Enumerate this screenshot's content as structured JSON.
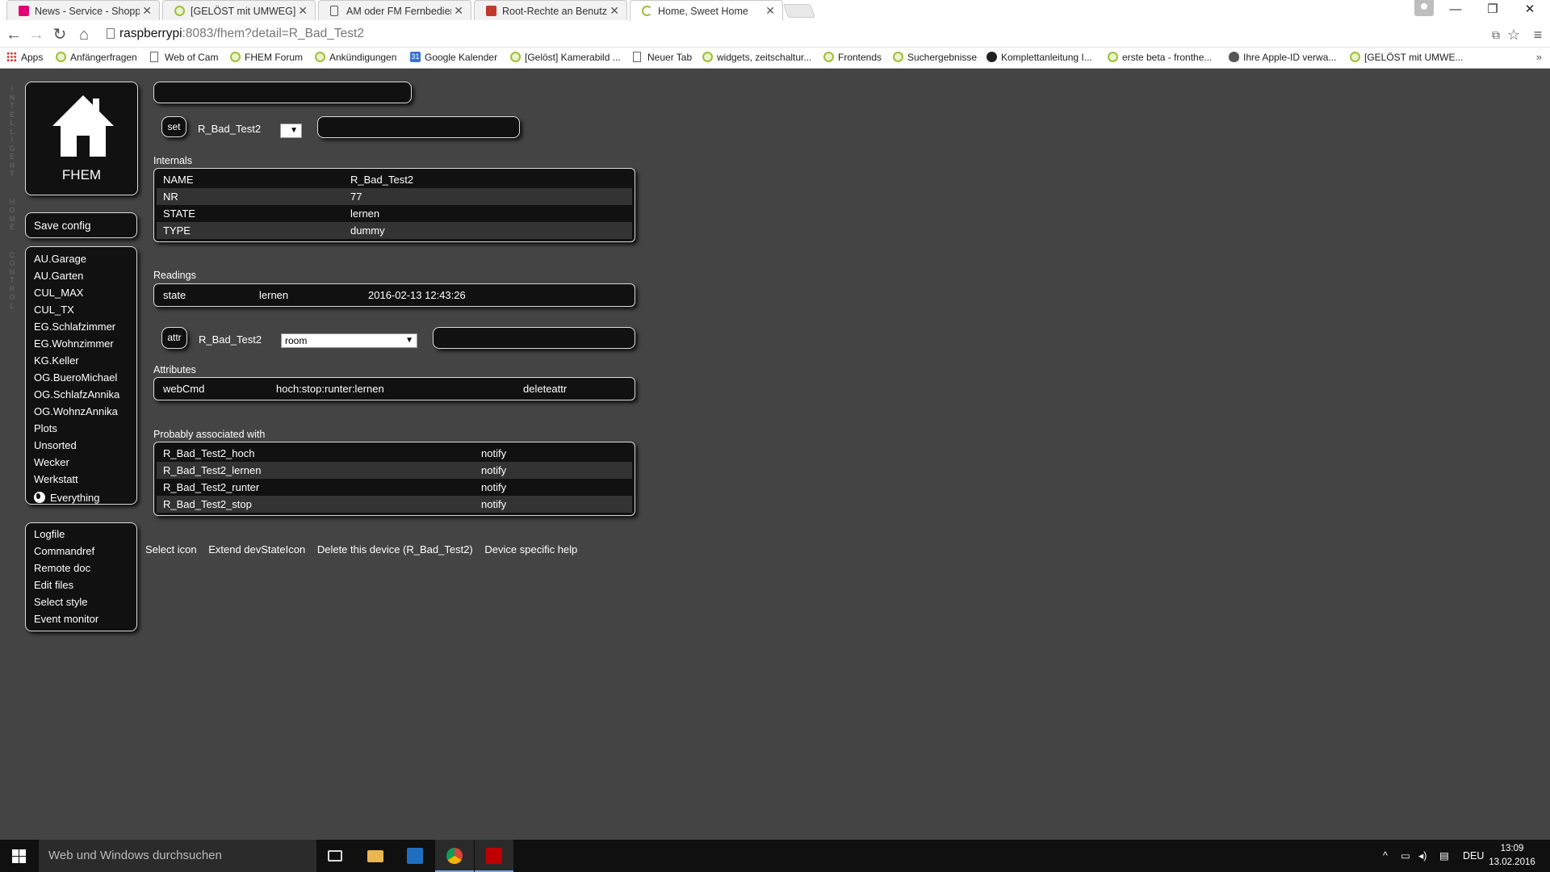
{
  "browser": {
    "tabs": [
      {
        "title": "News - Service - Shopping",
        "favicon_color": "#e20074",
        "active": false
      },
      {
        "title": "[GELÖST mit UMWEG] Do",
        "favicon_color": "#9fbf3a",
        "active": false
      },
      {
        "title": "AM oder FM Fernbedienun",
        "favicon_color": "#555555",
        "active": false
      },
      {
        "title": "Root-Rechte an Benutzer",
        "favicon_color": "#c0392b",
        "active": false
      },
      {
        "title": "Home, Sweet Home",
        "favicon_color": "#9fbf3a",
        "active": true
      }
    ],
    "url_host": "raspberrypi",
    "url_path": ":8083/fhem?detail=R_Bad_Test2",
    "bookmarks": [
      {
        "label": "Apps",
        "icon": "apps-grid-icon"
      },
      {
        "label": "Anfängerfragen",
        "icon": "fhem-icon"
      },
      {
        "label": "Web of Cam",
        "icon": "page-icon"
      },
      {
        "label": "FHEM Forum",
        "icon": "fhem-icon"
      },
      {
        "label": "Ankündigungen",
        "icon": "fhem-icon"
      },
      {
        "label": "Google Kalender",
        "icon": "calendar-icon"
      },
      {
        "label": "[Gelöst] Kamerabild ...",
        "icon": "fhem-icon"
      },
      {
        "label": "Neuer Tab",
        "icon": "page-icon"
      },
      {
        "label": "widgets, zeitschaltur...",
        "icon": "fhem-icon"
      },
      {
        "label": "Frontends",
        "icon": "fhem-icon"
      },
      {
        "label": "Suchergebnisse",
        "icon": "fhem-icon"
      },
      {
        "label": "Komplettanleitung I...",
        "icon": "github-icon"
      },
      {
        "label": "erste beta - fronthe...",
        "icon": "fhem-icon"
      },
      {
        "label": "Ihre Apple-ID verwa...",
        "icon": "apple-icon"
      },
      {
        "label": "[GELÖST mit UMWE...",
        "icon": "fhem-icon"
      }
    ],
    "bookmarks_more": "»",
    "calendar_badge": "31"
  },
  "fhem": {
    "side_label": "INTELLIGENT HOME CONTROL",
    "logo_text": "FHEM",
    "save_config": "Save config",
    "rooms": [
      "AU.Garage",
      "AU.Garten",
      "CUL_MAX",
      "CUL_TX",
      "EG.Schlafzimmer",
      "EG.Wohnzimmer",
      "KG.Keller",
      "OG.BueroMichael",
      "OG.SchlafzAnnika",
      "OG.WohnzAnnika",
      "Plots",
      "Unsorted",
      "Wecker",
      "Werkstatt"
    ],
    "everything": "Everything",
    "tools": [
      "Logfile",
      "Commandref",
      "Remote doc",
      "Edit files",
      "Select style",
      "Event monitor"
    ],
    "device": "R_Bad_Test2",
    "set_button": "set",
    "attr_button": "attr",
    "attr_selected": "room",
    "set_select_arrow": "▼",
    "internals_title": "Internals",
    "internals": [
      {
        "name": "NAME",
        "value": "R_Bad_Test2"
      },
      {
        "name": "NR",
        "value": "77"
      },
      {
        "name": "STATE",
        "value": "lernen"
      },
      {
        "name": "TYPE",
        "value": "dummy"
      }
    ],
    "readings_title": "Readings",
    "readings": [
      {
        "name": "state",
        "value": "lernen",
        "time": "2016-02-13 12:43:26"
      }
    ],
    "attributes_title": "Attributes",
    "attributes": [
      {
        "name": "webCmd",
        "value": "hoch:stop:runter:lernen",
        "action": "deleteattr"
      }
    ],
    "associated_title": "Probably associated with",
    "associated": [
      {
        "name": "R_Bad_Test2_hoch",
        "type": "notify"
      },
      {
        "name": "R_Bad_Test2_lernen",
        "type": "notify"
      },
      {
        "name": "R_Bad_Test2_runter",
        "type": "notify"
      },
      {
        "name": "R_Bad_Test2_stop",
        "type": "notify"
      }
    ],
    "bottom_links": [
      "Select icon",
      "Extend devStateIcon",
      "Delete this device (R_Bad_Test2)",
      "Device specific help"
    ]
  },
  "taskbar": {
    "search_placeholder": "Web und Windows durchsuchen",
    "language": "DEU",
    "time": "13:09",
    "date": "13.02.2016"
  }
}
